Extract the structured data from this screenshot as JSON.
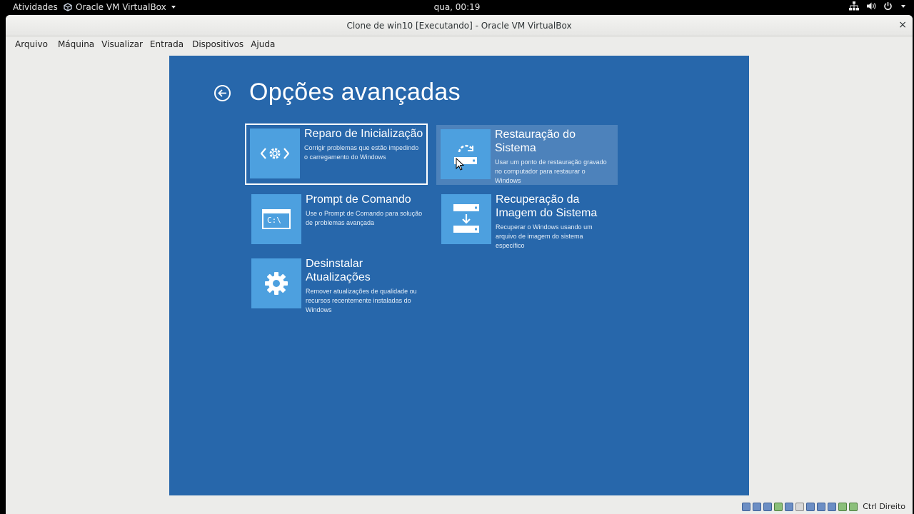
{
  "topbar": {
    "activities": "Atividades",
    "app_name": "Oracle VM VirtualBox",
    "clock": "qua, 00:19"
  },
  "window": {
    "title": "Clone de win10 [Executando] - Oracle VM VirtualBox",
    "close_glyph": "×",
    "menu": [
      "Arquivo",
      "Máquina",
      "Visualizar",
      "Entrada",
      "Dispositivos",
      "Ajuda"
    ]
  },
  "vm": {
    "heading": "Opções avançadas",
    "tiles": [
      {
        "icon": "startup-repair-icon",
        "title": "Reparo de Inicialização",
        "description": "Corrigir problemas que estão impedindo o carregamento do Windows"
      },
      {
        "icon": "system-restore-icon",
        "title": "Restauração do Sistema",
        "description": "Usar um ponto de restauração gravado no computador para restaurar o Windows"
      },
      {
        "icon": "command-prompt-icon",
        "icon_text": "C:\\",
        "title": "Prompt de Comando",
        "description": "Use o Prompt de Comando para solução de problemas avançada"
      },
      {
        "icon": "system-image-recovery-icon",
        "title": "Recuperação da Imagem do Sistema",
        "description": "Recuperar o Windows usando um arquivo de imagem do sistema específico"
      },
      {
        "icon": "uninstall-updates-gear-icon",
        "title": "Desinstalar Atualizações",
        "description": "Remover atualizações de qualidade ou recursos recentemente instaladas do Windows"
      }
    ]
  },
  "statusbar": {
    "host_key": "Ctrl Direito"
  },
  "colors": {
    "vm_background": "#2767ab",
    "tile_icon": "#4da0df",
    "tile_hover": "#4d82bb"
  }
}
